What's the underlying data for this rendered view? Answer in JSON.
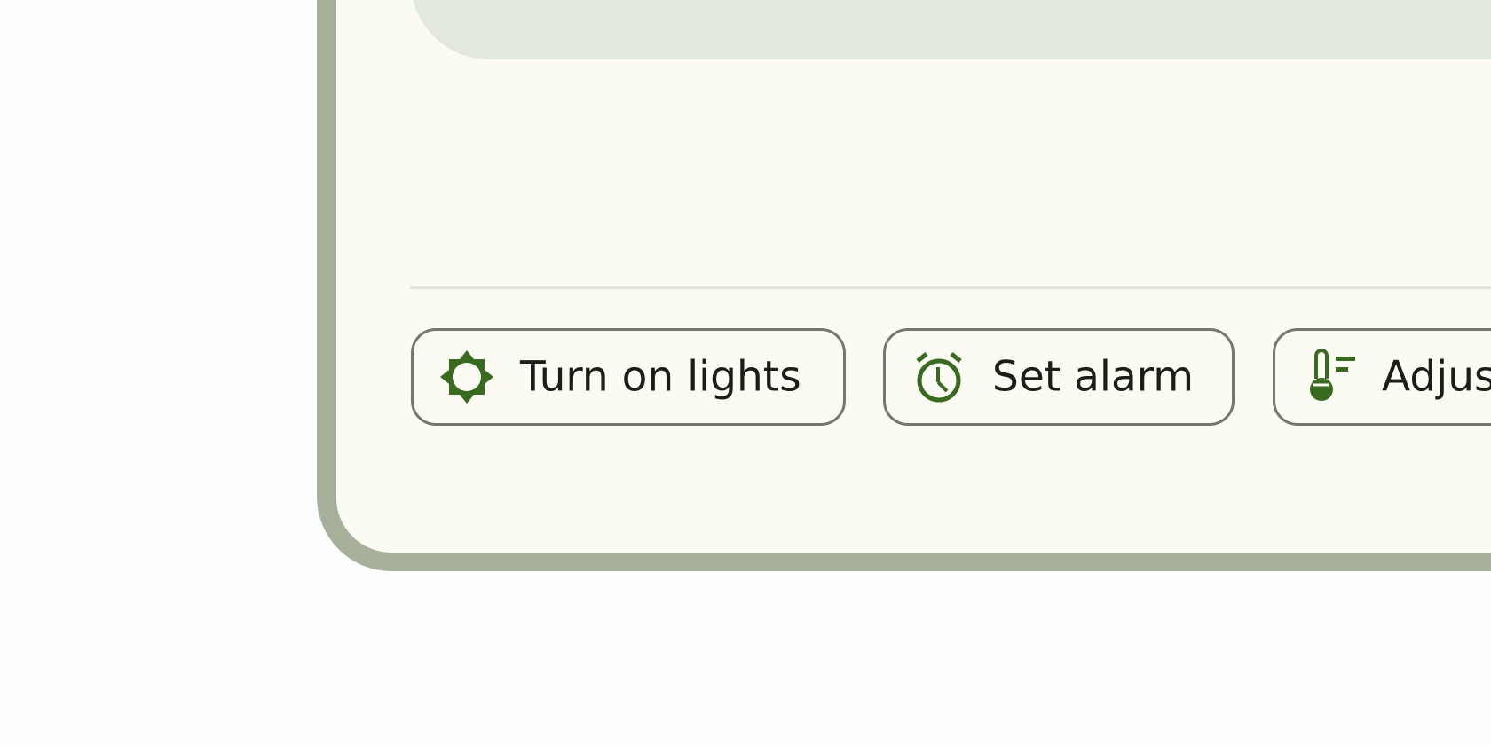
{
  "colors": {
    "frame": "#a6b09b",
    "screen": "#fbfbf4",
    "card": "#e2e8dc",
    "chip_border": "#74786f",
    "icon": "#386a20",
    "text": "#1b1d17"
  },
  "suggestions": [
    {
      "label": "Turn on lights",
      "icon": "brightness-icon"
    },
    {
      "label": "Set alarm",
      "icon": "alarm-icon"
    },
    {
      "label": "Adjust",
      "icon": "thermostat-icon"
    }
  ]
}
